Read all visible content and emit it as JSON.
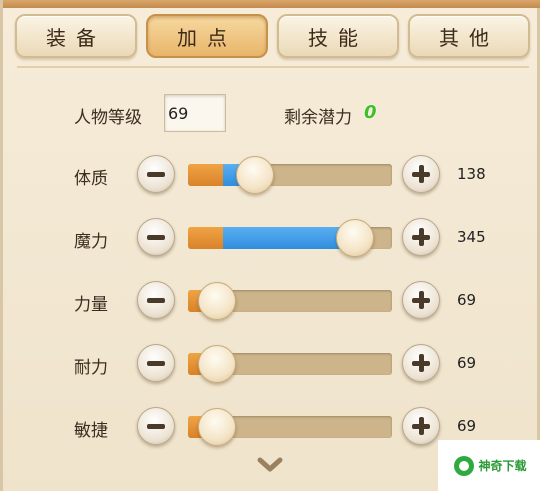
{
  "tabs": [
    {
      "label": "装备",
      "active": false
    },
    {
      "label": "加点",
      "active": true
    },
    {
      "label": "技能",
      "active": false
    },
    {
      "label": "其他",
      "active": false
    }
  ],
  "level": {
    "label": "人物等级",
    "value": "69"
  },
  "remaining": {
    "label": "剩余潜力",
    "value": "0"
  },
  "attributes": [
    {
      "label": "体质",
      "value": "138",
      "base_fraction": 0.17,
      "slider_fraction": 0.33
    },
    {
      "label": "魔力",
      "value": "345",
      "base_fraction": 0.17,
      "slider_fraction": 0.82
    },
    {
      "label": "力量",
      "value": "69",
      "base_fraction": 0.12,
      "slider_fraction": 0.14
    },
    {
      "label": "耐力",
      "value": "69",
      "base_fraction": 0.12,
      "slider_fraction": 0.14
    },
    {
      "label": "敏捷",
      "value": "69",
      "base_fraction": 0.12,
      "slider_fraction": 0.14
    }
  ],
  "icons": {
    "minus": "minus-icon",
    "plus": "plus-icon",
    "more": "chevron-down-icon"
  },
  "watermark": {
    "text": "神奇下载"
  },
  "colors": {
    "base_fill": "#e8922f",
    "added_fill": "#3f9ae6",
    "remaining_value": "#3fbf2a"
  }
}
